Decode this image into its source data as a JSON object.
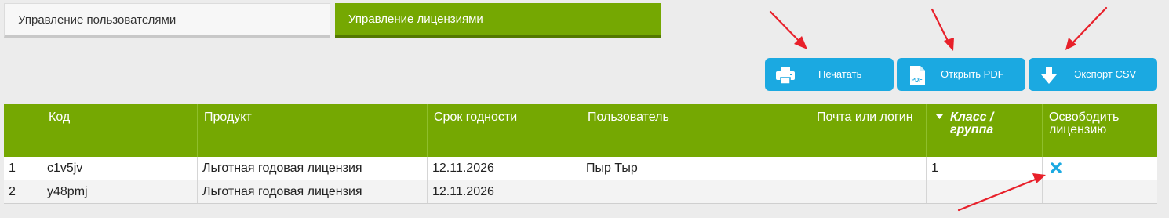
{
  "tabs": {
    "users": "Управление пользователями",
    "licenses": "Управление лицензиями"
  },
  "actions": {
    "print": "Печатать",
    "pdf": "Открыть PDF",
    "pdf_icon_text": "PDF",
    "csv": "Экспорт CSV"
  },
  "table": {
    "headers": {
      "num": "",
      "code": "Код",
      "product": "Продукт",
      "expiry": "Срок годности",
      "user": "Пользователь",
      "email": "Почта или логин",
      "class": "Класс / группа",
      "release": "Освободить лицензию"
    },
    "rows": [
      {
        "num": "1",
        "code": "c1v5jv",
        "product": "Льготная годовая лицензия",
        "expiry": "12.11.2026",
        "user": "Пыр Тыр",
        "email": "",
        "class": "1",
        "release": "release-icon"
      },
      {
        "num": "2",
        "code": "y48pmj",
        "product": "Льготная годовая лицензия",
        "expiry": "12.11.2026",
        "user": "",
        "email": "",
        "class": "",
        "release": ""
      }
    ]
  },
  "colors": {
    "accent_green": "#75a802",
    "button_blue": "#1ba9e1",
    "arrow_red": "#e8202a",
    "release_icon": "#1ba9e1"
  }
}
